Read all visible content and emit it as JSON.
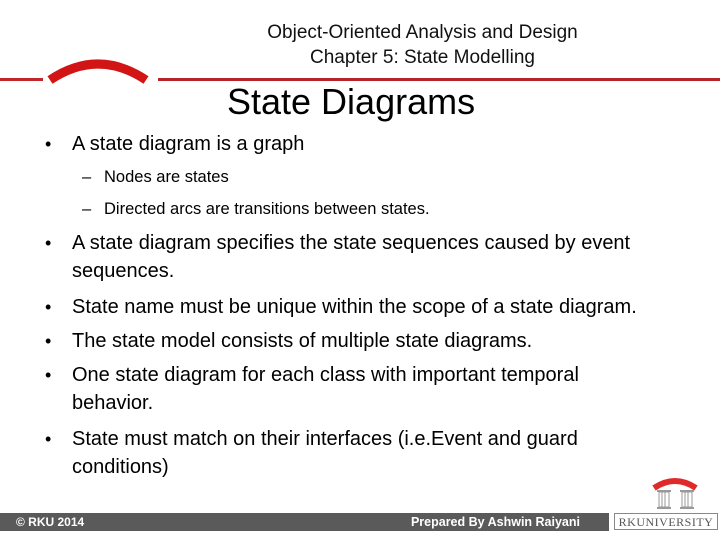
{
  "header": {
    "course_title_line1": "Object-Oriented Analysis and Design",
    "course_title_line2": "Chapter 5: State Modelling",
    "accent_color": "#c0262a"
  },
  "slide": {
    "title": "State Diagrams",
    "bullets": [
      {
        "text": "A state diagram is a graph",
        "sub": [
          "Nodes are states",
          "Directed arcs are transitions between states."
        ]
      },
      {
        "text_line1": "A state diagram specifies the state sequences caused by event",
        "text_line2": "sequences."
      },
      {
        "text": "State name must be unique within the scope of a state diagram."
      },
      {
        "text": "The state model consists of multiple state diagrams."
      },
      {
        "text_line1": "One state diagram for each class with important temporal",
        "text_line2": "behavior."
      },
      {
        "text_line1": "State must match on their interfaces (i.e.Event and guard",
        "text_line2": "conditions)"
      }
    ],
    "bullet_glyph": "•",
    "sub_glyph": "–"
  },
  "footer": {
    "copyright": "© RKU 2014",
    "author": "Prepared By Ashwin Raiyani",
    "logo_text": "RKUNIVERSITY"
  }
}
